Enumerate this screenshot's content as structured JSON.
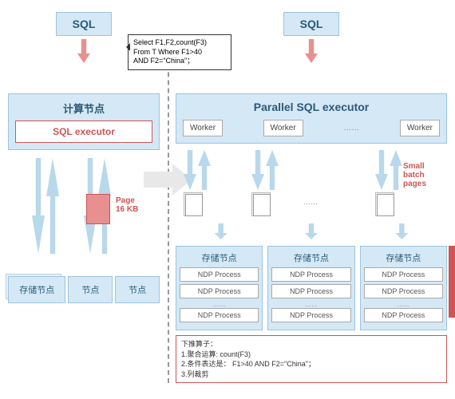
{
  "left": {
    "sql": "SQL",
    "compute_title": "计算节点",
    "sql_executor": "SQL executor",
    "page_label1": "Page",
    "page_label2": "16 KB",
    "storage1": "存储节点",
    "storage2": "节点",
    "storage3": "节点"
  },
  "callout": {
    "line1": "Select F1,F2,count(F3)",
    "line2": "From T Where F1>40",
    "line3": "AND F2=\"China\"；"
  },
  "right": {
    "sql": "SQL",
    "parallel_title": "Parallel SQL executor",
    "worker1": "Worker",
    "worker2": "Worker",
    "worker3": "Worker",
    "dots": "……",
    "small_batch1": "Small",
    "small_batch2": "batch",
    "small_batch3": "pages",
    "storage_title": "存储节点",
    "ndp": "NDP Process",
    "ndp_dots": "……"
  },
  "pushdown": {
    "title": "下推算子：",
    "l1": "1.聚合运算: count(F3)",
    "l2": "2.条件表达是： F1>40 AND F2=\"China\"；",
    "l3": "3.列裁剪"
  }
}
